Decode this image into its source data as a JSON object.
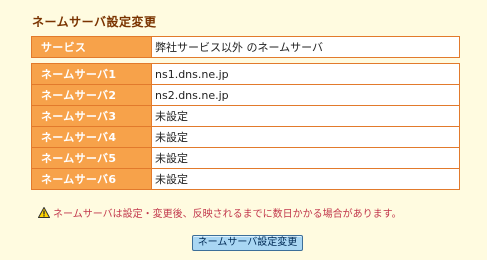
{
  "page": {
    "title": "ネームサーバ設定変更"
  },
  "service": {
    "label": "サービス",
    "value": "弊社サービス以外 のネームサーバ"
  },
  "nameservers": [
    {
      "label": "ネームサーバ1",
      "value": "ns1.dns.ne.jp"
    },
    {
      "label": "ネームサーバ2",
      "value": "ns2.dns.ne.jp"
    },
    {
      "label": "ネームサーバ3",
      "value": "未設定"
    },
    {
      "label": "ネームサーバ4",
      "value": "未設定"
    },
    {
      "label": "ネームサーバ5",
      "value": "未設定"
    },
    {
      "label": "ネームサーバ6",
      "value": "未設定"
    }
  ],
  "notice": {
    "icon": "warning-icon",
    "text": "ネームサーバは設定・変更後、反映されるまでに数日かかる場合があります。"
  },
  "actions": {
    "submit_label": "ネームサーバ設定変更"
  },
  "colors": {
    "header_cell": "#f7a24a",
    "border": "#e27a2c",
    "background": "#fffbe0",
    "notice_text": "#c2384c",
    "button": "#a9d6f3"
  }
}
